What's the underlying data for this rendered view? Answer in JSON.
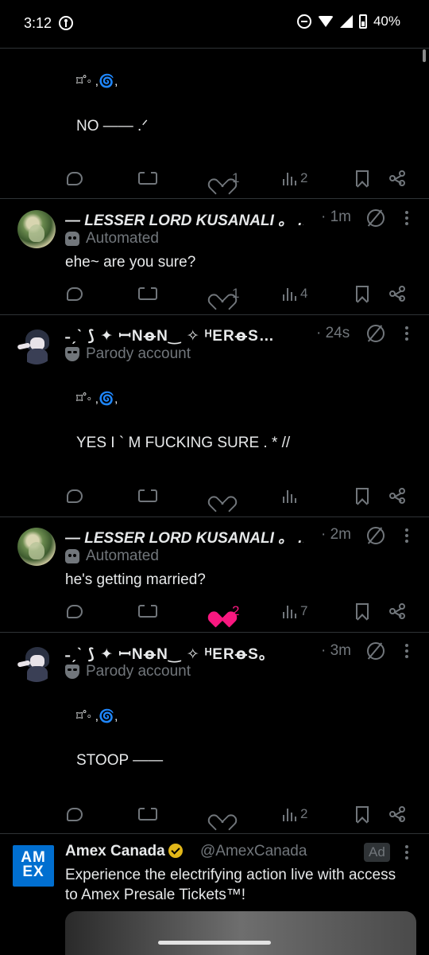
{
  "status": {
    "time": "3:12",
    "battery": "40%"
  },
  "tweets": [
    {
      "lines": [
        "⌑˚◦ ,🌀,",
        "NO —— .ᐟ"
      ],
      "reply": "",
      "retweet": "",
      "likes": "1",
      "views": "2"
    },
    {
      "name": "— LESSER LORD KUSANALI 。 …",
      "time": "· 1m",
      "label": "Automated",
      "text": "ehe~ are you sure?",
      "likes": "1",
      "views": "4"
    },
    {
      "name": "˗ˏˋ ⟆ ✦ ꟷNꝋN‿ ✧ ᴴERꝋS…",
      "time": "· 24s",
      "label": "Parody account",
      "lines": [
        "⌑˚◦ ,🌀,",
        "YES I ` M FUCKING SURE . * //"
      ],
      "likes": "",
      "views": ""
    },
    {
      "name": "— LESSER LORD KUSANALI 。 …",
      "time": "· 2m",
      "label": "Automated",
      "text": "he's getting married?",
      "likes": "2",
      "views": "7"
    },
    {
      "name": "˗ˏˋ ⟆ ✦ ꟷNꝋN‿ ✧ ᴴERꝋS。",
      "time": "· 3m",
      "label": "Parody account",
      "lines": [
        "⌑˚◦ ,🌀,",
        "STOOP ——"
      ],
      "likes": "",
      "views": "2"
    }
  ],
  "ad": {
    "logo": "AM EX",
    "name": "Amex Canada",
    "handle": "@AmexCanada",
    "badge": "Ad",
    "text": "Experience the electrifying action live with access to Amex Presale Tickets™!"
  },
  "colors": {
    "accent": "#1d9bf0",
    "like": "#f91880",
    "muted": "#71767b",
    "divider": "#2f3336"
  }
}
